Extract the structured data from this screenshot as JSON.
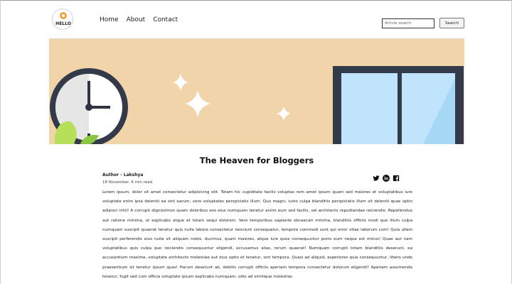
{
  "header": {
    "logo_text": "HELLO",
    "nav": [
      {
        "label": "Home"
      },
      {
        "label": "About"
      },
      {
        "label": "Contact"
      }
    ],
    "search": {
      "placeholder": "Article search",
      "button_label": "Search"
    }
  },
  "hero": {
    "background": "#f2d4ab",
    "illustration": [
      "clock",
      "sparkles",
      "window",
      "leaf"
    ]
  },
  "article": {
    "title": "The Heaven for Bloggers",
    "author": "Author - Lakshya",
    "meta": "18 November. 6 min read",
    "socials": [
      {
        "icon": "twitter-icon"
      },
      {
        "icon": "linkedin-icon"
      },
      {
        "icon": "facebook-icon"
      }
    ],
    "body": "Lorem ipsum, dolor sit amet consectetur adipisicing elit. Totam hic cupiditate facilis voluptas rem amet ipsum quam sed maiores et voluptatibus iure voluptate enim ipsa deleniti ea sint earum, vero voluptates perspiciatis illum. Quo magni, iusto culpa blanditiis perspiciatis illum sit deleniti quae optio adipisci nihil! A corrupti dignissimos quam doloribus eos eius numquam tenetur animi eum sed facilis, vel architecto repudiandae reiciendis. Repellendus aut ratione minima, ut explicabo atque et totam sequi dolorem. Vero temporibus sapiente obcaecati minima, blanditiis officiis modi quo illum culpa numquam suscipit quaerat tenetur quis nulla labore consectetur nesciunt consequatur, tempore commodi sunt qui error vitae laborum cum! Quia ullam suscipit perferendis eius nulla sit aliquam nobis, ducimus, quam maiores, atque iure quos consequuntur porro eum neque est minus! Quae aut nam voluptatibus quis culpa quo reiciendis consequuntur eligendi, accusamus alias, rerum quaerat! Numquam corrupti totam blanditiis deserunt, ea accusantium maxime, voluptate architecto molestiae aut eius optio et tenetur, sint tempora. Quasi ad aliquid, asperiores quia consequuntur, libero unde praesentium sit tenetur ipsum quas! Harum deserunt ab, debitis corrupti officiis aperiam tempora consectetur dolorum eligendi? Aperiam assumenda tenetur, fugit sed cum officia voluptate ipsum explicabo numquam, odio ad similique molestias"
  }
}
